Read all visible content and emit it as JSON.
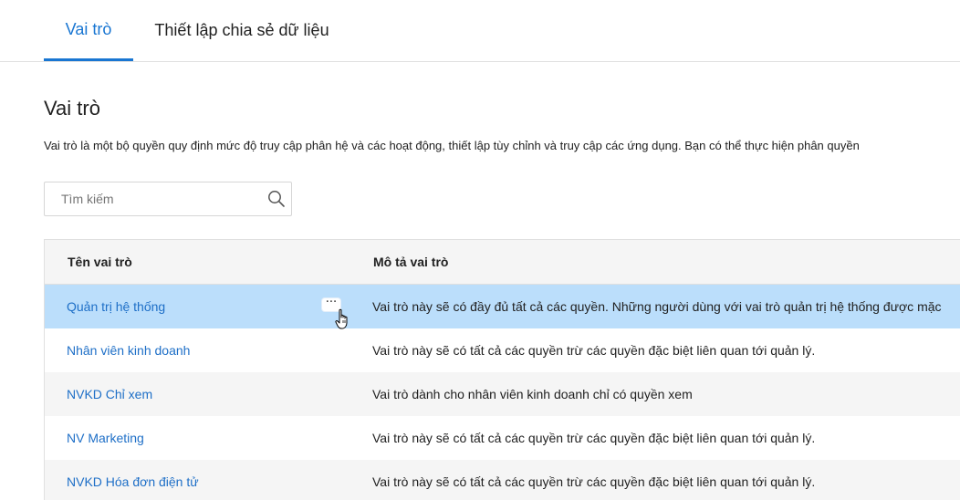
{
  "tabs": [
    {
      "label": "Vai trò",
      "active": true
    },
    {
      "label": "Thiết lập chia sẻ dữ liệu",
      "active": false
    }
  ],
  "page": {
    "title": "Vai trò",
    "description": "Vai trò là một bộ quyền quy định mức độ truy cập phân hệ và các hoạt động, thiết lập tùy chỉnh và truy cập các ứng dụng. Bạn có thể thực hiện phân quyền"
  },
  "search": {
    "placeholder": "Tìm kiếm",
    "value": "",
    "icon": "search-icon"
  },
  "table": {
    "headers": {
      "name": "Tên vai trò",
      "description": "Mô tả vai trò"
    },
    "rows": [
      {
        "name": "Quản trị hệ thống",
        "description": "Vai trò này sẽ có đầy đủ tất cả các quyền. Những người dùng với vai trò quản trị hệ thống được mặc",
        "selected": true
      },
      {
        "name": "Nhân viên kinh doanh",
        "description": "Vai trò này sẽ có tất cả các quyền trừ các quyền đặc biệt liên quan tới quản lý.",
        "selected": false
      },
      {
        "name": "NVKD Chỉ xem",
        "description": "Vai trò dành cho nhân viên kinh doanh chỉ có quyền xem",
        "selected": false
      },
      {
        "name": "NV Marketing",
        "description": "Vai trò này sẽ có tất cả các quyền trừ các quyền đặc biệt liên quan tới quản lý.",
        "selected": false
      },
      {
        "name": "NVKD Hóa đơn điện tử",
        "description": "Vai trò này sẽ có tất cả các quyền trừ các quyền đặc biệt liên quan tới quản lý.",
        "selected": false
      }
    ],
    "more_icon": "···"
  },
  "colors": {
    "accent": "#1976d2",
    "link": "#1e6fc7",
    "selected_row": "#bbdefb",
    "header_bg": "#f5f5f5"
  }
}
